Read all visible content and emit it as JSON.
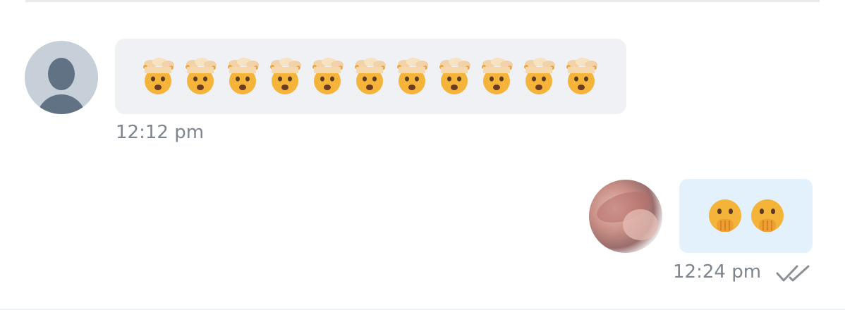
{
  "conversation": {
    "incoming": {
      "avatar": "default-user-avatar",
      "emoji_name": "exploding-head-emoji",
      "emoji_count": 11,
      "time": "12:12 pm"
    },
    "outgoing": {
      "avatar": "user-photo-avatar",
      "emoji_name": "face-with-hand-over-mouth-emoji",
      "emoji_count": 2,
      "time": "12:24 pm",
      "status_icon": "double-check-read-icon"
    }
  },
  "colors": {
    "incoming_bubble": "#f0f1f4",
    "outgoing_bubble": "#e2f1fb",
    "timestamp": "#7d858f",
    "ticks": "#8b9096"
  }
}
